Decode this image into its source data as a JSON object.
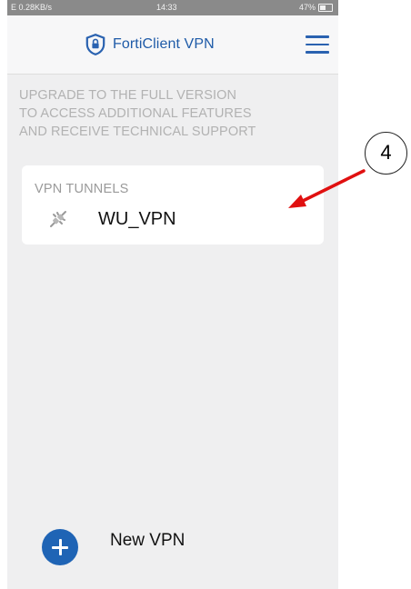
{
  "status_bar": {
    "left_text": "E 0.28KB/s",
    "time": "14:33",
    "battery_text": "47%"
  },
  "header": {
    "title": "FortiClient VPN",
    "logo_icon": "shield-lock-icon",
    "menu_icon": "hamburger-menu-icon",
    "brand_color": "#1f5ba8"
  },
  "upgrade_banner": {
    "lines": [
      "UPGRADE TO THE FULL VERSION",
      "TO ACCESS ADDITIONAL FEATURES",
      "AND RECEIVE TECHNICAL SUPPORT"
    ]
  },
  "tunnels": {
    "header": "VPN TUNNELS",
    "items": [
      {
        "name": "WU_VPN",
        "status_icon": "disconnected-plug-icon"
      }
    ]
  },
  "new_vpn": {
    "label": "New VPN",
    "icon": "plus-circle-icon",
    "color": "#1f64b5"
  },
  "annotation": {
    "callout_number": "4",
    "arrow_color": "#e01010"
  }
}
